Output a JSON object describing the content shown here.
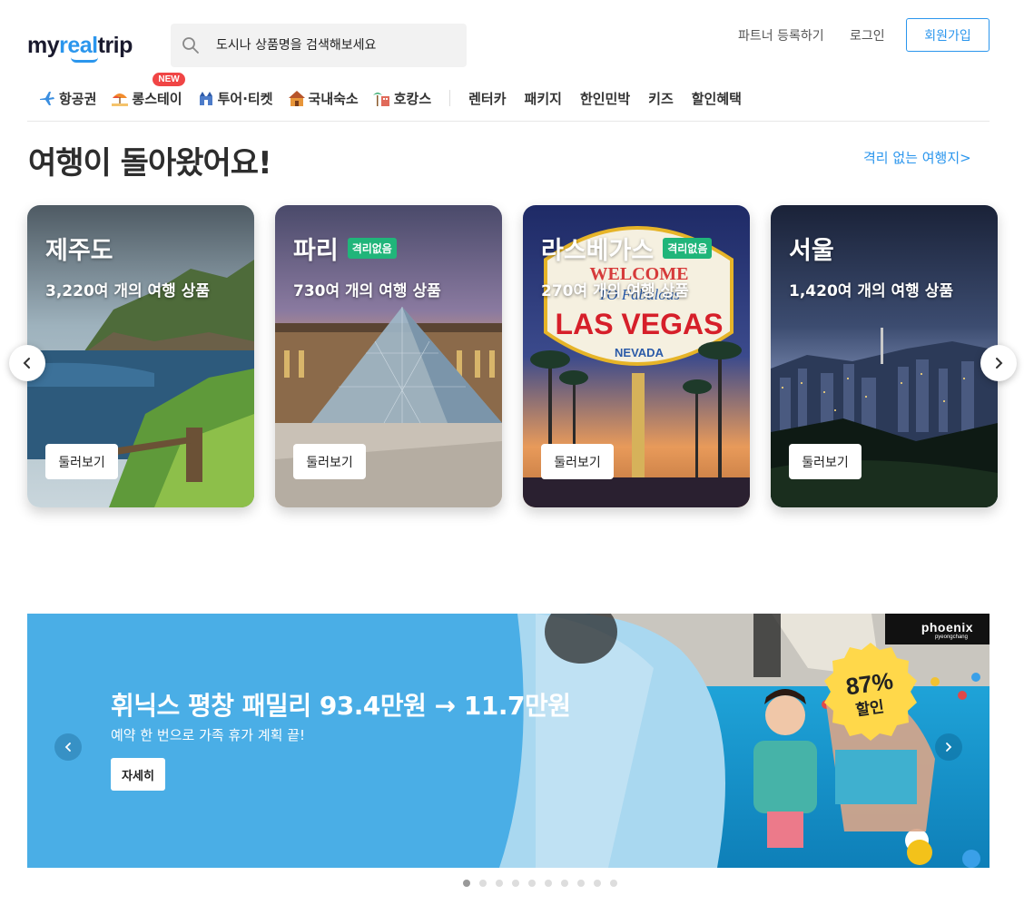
{
  "brand": {
    "logo_text_1": "my",
    "logo_text_2": "real",
    "logo_text_3": "trip"
  },
  "search": {
    "placeholder": "도시나 상품명을 검색해보세요"
  },
  "header": {
    "partner_label": "파트너 등록하기",
    "login_label": "로그인",
    "signup_label": "회원가입"
  },
  "nav": {
    "items": [
      {
        "label": "항공권",
        "icon": "airplane-icon"
      },
      {
        "label": "롱스테이",
        "icon": "beach-icon",
        "badge": "NEW"
      },
      {
        "label": "투어·티켓",
        "icon": "castle-icon"
      },
      {
        "label": "국내숙소",
        "icon": "house-icon"
      },
      {
        "label": "호캉스",
        "icon": "palm-hotel-icon"
      }
    ],
    "plain_items": [
      "렌터카",
      "패키지",
      "한인민박",
      "키즈",
      "할인혜택"
    ]
  },
  "section": {
    "title": "여행이 돌아왔어요!",
    "link_label": "격리 없는 여행지>"
  },
  "cards": [
    {
      "title": "제주도",
      "count": "3,220여 개의 여행 상품",
      "button": "둘러보기",
      "badge": ""
    },
    {
      "title": "파리",
      "count": "730여 개의 여행 상품",
      "button": "둘러보기",
      "badge": "격리없음"
    },
    {
      "title": "라스베가스",
      "count": "270여 개의 여행 상품",
      "button": "둘러보기",
      "badge": "격리없음"
    },
    {
      "title": "서울",
      "count": "1,420여 개의 여행 상품",
      "button": "둘러보기",
      "badge": ""
    }
  ],
  "card_art": {
    "vegas_sign_1": "WELCOME",
    "vegas_sign_2": "TO Fabulous",
    "vegas_sign_3": "LAS VEGAS",
    "vegas_sign_4": "NEVADA"
  },
  "banner": {
    "title": "휘닉스 평창 패밀리 93.4만원 → 11.7만원",
    "subtitle": "예약 한 번으로 가족 휴가 계획 끝!",
    "button": "자세히",
    "discount_1": "87%",
    "discount_2": "할인",
    "brand_1": "phoenix",
    "brand_2": "pyeongchang"
  },
  "pagination": {
    "total": 10,
    "active": 0
  },
  "colors": {
    "accent": "#2b96ed",
    "badge_green": "#20b57a",
    "new_red": "#f04545",
    "banner_bg": "#4aaee6"
  }
}
